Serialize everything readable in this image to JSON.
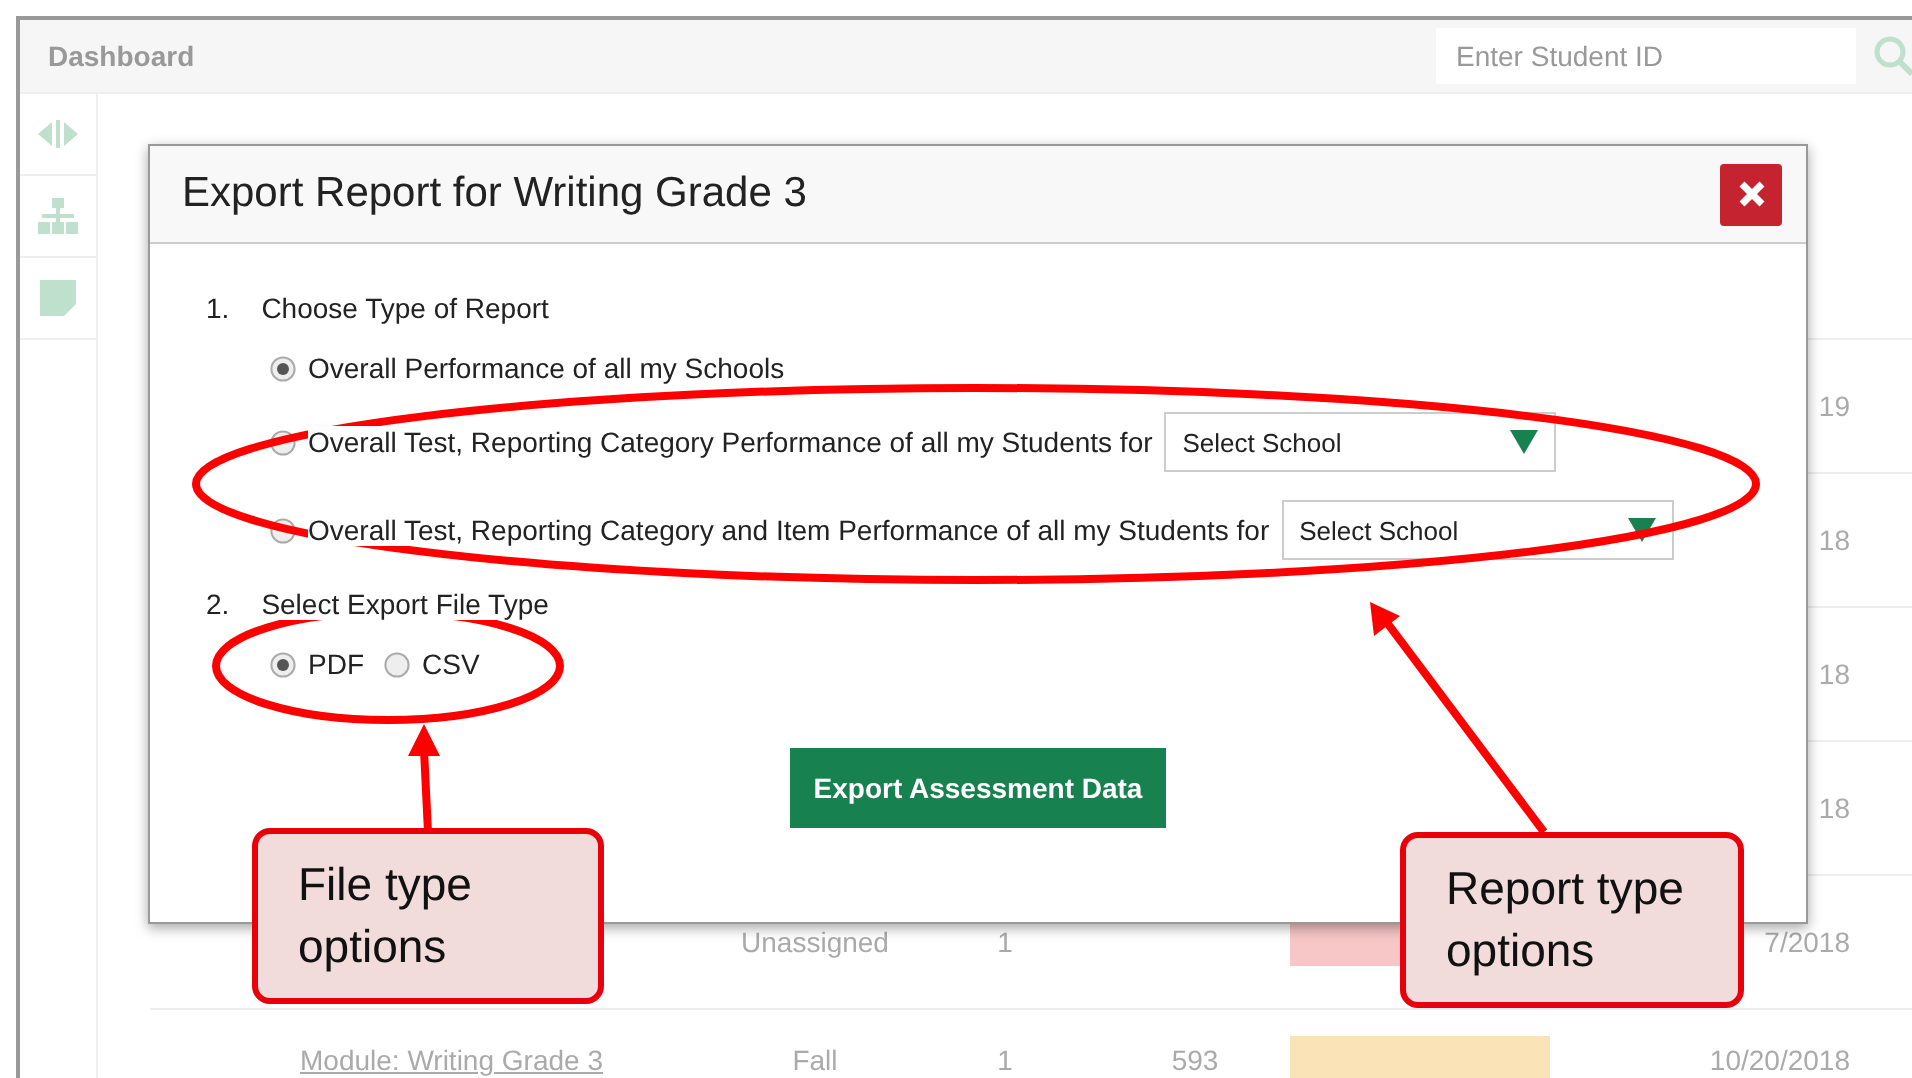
{
  "header": {
    "title": "Dashboard",
    "search": {
      "placeholder": "Enter Student ID"
    }
  },
  "table": {
    "rows": [
      {
        "date": "19"
      },
      {
        "date": "18"
      },
      {
        "date": "18"
      },
      {
        "date": "18"
      },
      {
        "season": "Unassigned",
        "count": "1",
        "date": "7/2018",
        "color": "#f7c6c6"
      },
      {
        "name": "Module: Writing Grade 3",
        "season": "Fall",
        "count": "1",
        "score": "593",
        "date": "10/20/2018",
        "color": "#fbe3b8"
      }
    ]
  },
  "dialog": {
    "title": "Export Report for Writing Grade 3",
    "steps": [
      {
        "number": "1.",
        "label": "Choose Type of Report"
      },
      {
        "number": "2.",
        "label": "Select Export File Type"
      }
    ],
    "report_options": [
      {
        "label": "Overall Performance of all my Schools",
        "selected": true
      },
      {
        "label": "Overall Test, Reporting Category Performance of all my Students for",
        "selected": false,
        "select": "Select School"
      },
      {
        "label": "Overall Test, Reporting Category and Item Performance of all my Students for",
        "selected": false,
        "select": "Select School"
      }
    ],
    "file_types": [
      {
        "label": "PDF",
        "selected": true
      },
      {
        "label": "CSV",
        "selected": false
      }
    ],
    "button": "Export Assessment Data"
  },
  "callouts": [
    {
      "kind": "file",
      "text": "File type options"
    },
    {
      "kind": "report",
      "text": "Report type options"
    }
  ]
}
